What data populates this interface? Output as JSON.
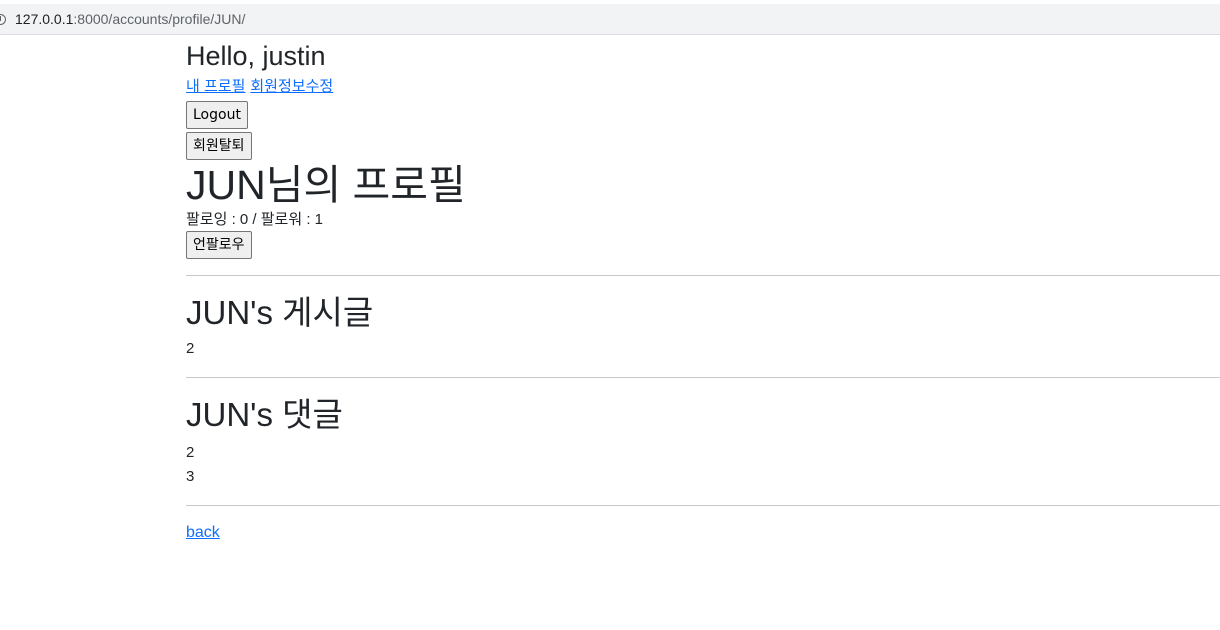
{
  "browser": {
    "url_host": "127.0.0.1",
    "url_path": ":8000/accounts/profile/JUN/"
  },
  "nav": {
    "greeting": "Hello, justin",
    "my_profile_link": "내 프로필",
    "edit_account_link": "회원정보수정",
    "logout_button": "Logout",
    "delete_account_button": "회원탈퇴"
  },
  "profile": {
    "title": "JUN님의 프로필",
    "follow_summary": "팔로잉 : 0 / 팔로워 : 1",
    "unfollow_button": "언팔로우"
  },
  "articles": {
    "heading": "JUN's 게시글",
    "items": [
      "2"
    ]
  },
  "comments": {
    "heading": "JUN's 댓글",
    "items": [
      "2",
      "3"
    ]
  },
  "footer": {
    "back_link": "back"
  },
  "colors": {
    "link": "#0d6efd",
    "text": "#212529",
    "divider": "#c8c8c8"
  }
}
